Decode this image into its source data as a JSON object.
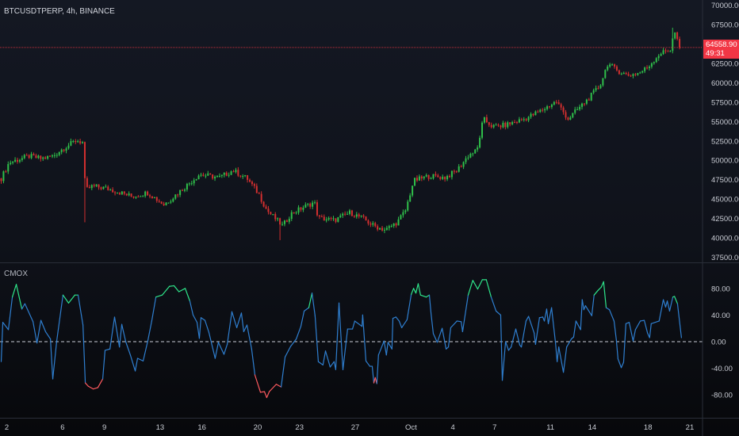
{
  "header": {
    "symbol_title": "BTCUSDTPERP, 4h, BINANCE"
  },
  "indicator": {
    "title": "CMOX"
  },
  "last_price": {
    "value": "64558.90",
    "countdown": "49:31",
    "price": 64558.9
  },
  "colors": {
    "up": "#2fbf4a",
    "down": "#d32f2f",
    "cmox_line": "#2f7fd0",
    "cmox_high": "#2ee58a",
    "cmox_low": "#ff5a5f",
    "price_line": "#f23645"
  },
  "chart_data": [
    {
      "type": "candlestick",
      "title": "BTCUSDTPERP, 4h, BINANCE",
      "x_unit": "bar (4h)",
      "ylim": [
        36500,
        71000
      ],
      "y_ticks": [
        37500,
        40000,
        42500,
        45000,
        47500,
        50000,
        52500,
        55000,
        57500,
        60000,
        62500,
        65000,
        67500,
        70000
      ],
      "y_tick_labels": [
        "37500.00",
        "40000.00",
        "42500.00",
        "45000.00",
        "47500.00",
        "50000.00",
        "52500.00",
        "55000.00",
        "57500.00",
        "60000.00",
        "62500.00",
        "67500.00",
        "70000.00"
      ],
      "close_path": [
        [
          0,
          47670
        ],
        [
          3.4,
          49710
        ],
        [
          11.9,
          50530
        ],
        [
          17.1,
          50220
        ],
        [
          22.2,
          50530
        ],
        [
          26.3,
          51450
        ],
        [
          32.4,
          52580
        ],
        [
          35.2,
          52270
        ],
        [
          36.2,
          46130
        ],
        [
          39.2,
          46650
        ],
        [
          44.4,
          46440
        ],
        [
          51.2,
          45830
        ],
        [
          56.3,
          45320
        ],
        [
          63.1,
          45830
        ],
        [
          70,
          44290
        ],
        [
          73.4,
          45110
        ],
        [
          80.2,
          46850
        ],
        [
          85.3,
          48180
        ],
        [
          93.9,
          47770
        ],
        [
          99.7,
          48690
        ],
        [
          105.8,
          47670
        ],
        [
          110.9,
          45620
        ],
        [
          114.3,
          43580
        ],
        [
          117.7,
          42560
        ],
        [
          121.2,
          41530
        ],
        [
          124.6,
          43070
        ],
        [
          129.7,
          43890
        ],
        [
          134.8,
          44600
        ],
        [
          136.5,
          42560
        ],
        [
          143.3,
          42250
        ],
        [
          150.2,
          43270
        ],
        [
          155.3,
          42560
        ],
        [
          160.4,
          41530
        ],
        [
          165.5,
          41020
        ],
        [
          170.6,
          42050
        ],
        [
          174.1,
          43580
        ],
        [
          177.5,
          47360
        ],
        [
          184.3,
          47980
        ],
        [
          191.1,
          47770
        ],
        [
          196.2,
          48690
        ],
        [
          201.4,
          50740
        ],
        [
          204.8,
          51250
        ],
        [
          207.5,
          55340
        ],
        [
          211.6,
          54320
        ],
        [
          216.7,
          54520
        ],
        [
          225.3,
          55340
        ],
        [
          232.1,
          56360
        ],
        [
          238.9,
          57590
        ],
        [
          244,
          55340
        ],
        [
          247.4,
          56360
        ],
        [
          252.6,
          57900
        ],
        [
          257.7,
          59630
        ],
        [
          261.1,
          62500
        ],
        [
          264.5,
          61680
        ],
        [
          269.6,
          60960
        ],
        [
          274.7,
          61270
        ],
        [
          278.2,
          61980
        ],
        [
          283.3,
          63720
        ],
        [
          288.4,
          64340
        ],
        [
          289.4,
          66790
        ],
        [
          292.5,
          64560
        ]
      ],
      "wick_extremes": [
        {
          "bar": 36,
          "low": 42000
        },
        {
          "bar": 120,
          "low": 39700
        },
        {
          "bar": 289,
          "high": 67100
        }
      ]
    },
    {
      "type": "line",
      "title": "CMOX",
      "ylim": [
        -100,
        100
      ],
      "y_ticks": [
        80,
        40,
        0,
        -40,
        -80
      ],
      "y_tick_labels": [
        "80.00",
        "40.00",
        "0.00",
        "-40.00",
        "-80.00"
      ],
      "zero_line": 0,
      "points": [
        [
          0,
          -30
        ],
        [
          0.7,
          29
        ],
        [
          3.1,
          18
        ],
        [
          4.8,
          67
        ],
        [
          6.5,
          86
        ],
        [
          8.9,
          49
        ],
        [
          10.2,
          57
        ],
        [
          13.7,
          30
        ],
        [
          15.4,
          -2
        ],
        [
          17.1,
          32
        ],
        [
          19.1,
          15
        ],
        [
          21.2,
          4
        ],
        [
          22.2,
          -56
        ],
        [
          23.9,
          1
        ],
        [
          26.6,
          70
        ],
        [
          29,
          58
        ],
        [
          31.7,
          70
        ],
        [
          33.1,
          70
        ],
        [
          35.2,
          25
        ],
        [
          36.2,
          -62
        ],
        [
          37.5,
          -67
        ],
        [
          39.6,
          -71
        ],
        [
          41.6,
          -69
        ],
        [
          43.7,
          -56
        ],
        [
          44.7,
          -13
        ],
        [
          46.8,
          -11
        ],
        [
          48.8,
          37
        ],
        [
          50.9,
          -8
        ],
        [
          51.9,
          26
        ],
        [
          53.6,
          0
        ],
        [
          55.6,
          -20
        ],
        [
          57.7,
          -44
        ],
        [
          58.7,
          -25
        ],
        [
          61.1,
          -29
        ],
        [
          63.1,
          1
        ],
        [
          64.8,
          31
        ],
        [
          66.6,
          67
        ],
        [
          69.3,
          70
        ],
        [
          72.4,
          83
        ],
        [
          74.4,
          84
        ],
        [
          76.5,
          75
        ],
        [
          79.2,
          80
        ],
        [
          81.2,
          61
        ],
        [
          82.6,
          40
        ],
        [
          84.3,
          29
        ],
        [
          85.3,
          5
        ],
        [
          86,
          36
        ],
        [
          87.7,
          32
        ],
        [
          89.4,
          14
        ],
        [
          92.1,
          -25
        ],
        [
          93.5,
          -1
        ],
        [
          95.9,
          -19
        ],
        [
          97.3,
          -4
        ],
        [
          99.3,
          45
        ],
        [
          101.4,
          21
        ],
        [
          103.4,
          43
        ],
        [
          104.4,
          15
        ],
        [
          105.8,
          25
        ],
        [
          107.8,
          -11
        ],
        [
          109.2,
          -50
        ],
        [
          111.6,
          -76
        ],
        [
          113.3,
          -75
        ],
        [
          114.3,
          -84
        ],
        [
          115.4,
          -75
        ],
        [
          118.4,
          -64
        ],
        [
          120.5,
          -68
        ],
        [
          122.2,
          -23
        ],
        [
          124.6,
          -7
        ],
        [
          127,
          4
        ],
        [
          129,
          23
        ],
        [
          130.4,
          46
        ],
        [
          132.4,
          51
        ],
        [
          133.8,
          73
        ],
        [
          135.1,
          39
        ],
        [
          136.5,
          -30
        ],
        [
          138.5,
          -35
        ],
        [
          139.6,
          -14
        ],
        [
          141.6,
          -38
        ],
        [
          143.3,
          -30
        ],
        [
          144,
          -42
        ],
        [
          145.4,
          58
        ],
        [
          147.1,
          -42
        ],
        [
          149.1,
          19
        ],
        [
          151.2,
          19
        ],
        [
          152.2,
          31
        ],
        [
          155.3,
          23
        ],
        [
          155.6,
          40
        ],
        [
          157,
          -29
        ],
        [
          158.7,
          -37
        ],
        [
          159.7,
          -37
        ],
        [
          160.4,
          -62
        ],
        [
          161,
          -54
        ],
        [
          161.7,
          -63
        ],
        [
          162.4,
          -20
        ],
        [
          164.8,
          1
        ],
        [
          165.8,
          -20
        ],
        [
          166.5,
          -1
        ],
        [
          168.2,
          -11
        ],
        [
          168.6,
          35
        ],
        [
          169.9,
          37
        ],
        [
          171.3,
          31
        ],
        [
          172.4,
          21
        ],
        [
          174.7,
          33
        ],
        [
          176.5,
          71
        ],
        [
          177.5,
          80
        ],
        [
          178.5,
          73
        ],
        [
          179.5,
          87
        ],
        [
          180.5,
          70
        ],
        [
          182.9,
          67
        ],
        [
          184.3,
          70
        ],
        [
          185,
          43
        ],
        [
          186,
          12
        ],
        [
          187.7,
          -1
        ],
        [
          189.8,
          20
        ],
        [
          191.5,
          -11
        ],
        [
          192.5,
          -8
        ],
        [
          193.5,
          21
        ],
        [
          196.2,
          31
        ],
        [
          198,
          30
        ],
        [
          198.6,
          15
        ],
        [
          201,
          70
        ],
        [
          203,
          92
        ],
        [
          205.1,
          79
        ],
        [
          207.1,
          93
        ],
        [
          208.8,
          93
        ],
        [
          210.9,
          67
        ],
        [
          213,
          46
        ],
        [
          215,
          40
        ],
        [
          215.7,
          -58
        ],
        [
          217.1,
          0
        ],
        [
          218.4,
          -13
        ],
        [
          219.5,
          -8
        ],
        [
          221.5,
          19
        ],
        [
          223.2,
          -5
        ],
        [
          223.9,
          -8
        ],
        [
          225.9,
          31
        ],
        [
          227,
          38
        ],
        [
          229.4,
          13
        ],
        [
          230,
          -4
        ],
        [
          231.7,
          36
        ],
        [
          233.1,
          37
        ],
        [
          233.8,
          31
        ],
        [
          234.8,
          49
        ],
        [
          235.5,
          27
        ],
        [
          236.9,
          51
        ],
        [
          238.6,
          -2
        ],
        [
          239.3,
          -30
        ],
        [
          240,
          -8
        ],
        [
          242,
          -46
        ],
        [
          243.4,
          -8
        ],
        [
          245.4,
          4
        ],
        [
          246.4,
          7
        ],
        [
          247.4,
          31
        ],
        [
          249.4,
          18
        ],
        [
          250.1,
          63
        ],
        [
          250.8,
          48
        ],
        [
          251.5,
          54
        ],
        [
          254.2,
          39
        ],
        [
          255.2,
          70
        ],
        [
          256.9,
          77
        ],
        [
          258.3,
          82
        ],
        [
          259.3,
          90
        ],
        [
          260.4,
          51
        ],
        [
          261.8,
          48
        ],
        [
          263.8,
          31
        ],
        [
          264.8,
          2
        ],
        [
          265.5,
          -26
        ],
        [
          266.9,
          -39
        ],
        [
          267.9,
          -31
        ],
        [
          268.9,
          27
        ],
        [
          270.3,
          29
        ],
        [
          272,
          1
        ],
        [
          273,
          18
        ],
        [
          275.1,
          31
        ],
        [
          276.8,
          32
        ],
        [
          278.2,
          13
        ],
        [
          279.1,
          6
        ],
        [
          279.8,
          27
        ],
        [
          283.2,
          31
        ],
        [
          285,
          63
        ],
        [
          286,
          52
        ],
        [
          286.7,
          61
        ],
        [
          287.7,
          46
        ],
        [
          289.1,
          67
        ],
        [
          289.8,
          68
        ],
        [
          291.1,
          57
        ],
        [
          292.8,
          6
        ]
      ]
    }
  ],
  "x_axis": {
    "ticks": [
      {
        "bar": 2.4,
        "label": "2"
      },
      {
        "bar": 26.4,
        "label": "6"
      },
      {
        "bar": 44.4,
        "label": "9"
      },
      {
        "bar": 68.4,
        "label": "13"
      },
      {
        "bar": 86.4,
        "label": "16"
      },
      {
        "bar": 110.4,
        "label": "20"
      },
      {
        "bar": 128.4,
        "label": "23"
      },
      {
        "bar": 152.4,
        "label": "27"
      },
      {
        "bar": 176.4,
        "label": "Oct"
      },
      {
        "bar": 194.4,
        "label": "4"
      },
      {
        "bar": 212.4,
        "label": "7"
      },
      {
        "bar": 236.4,
        "label": "11"
      },
      {
        "bar": 254.4,
        "label": "14"
      },
      {
        "bar": 278.4,
        "label": "18"
      },
      {
        "bar": 296.4,
        "label": "21"
      }
    ]
  }
}
